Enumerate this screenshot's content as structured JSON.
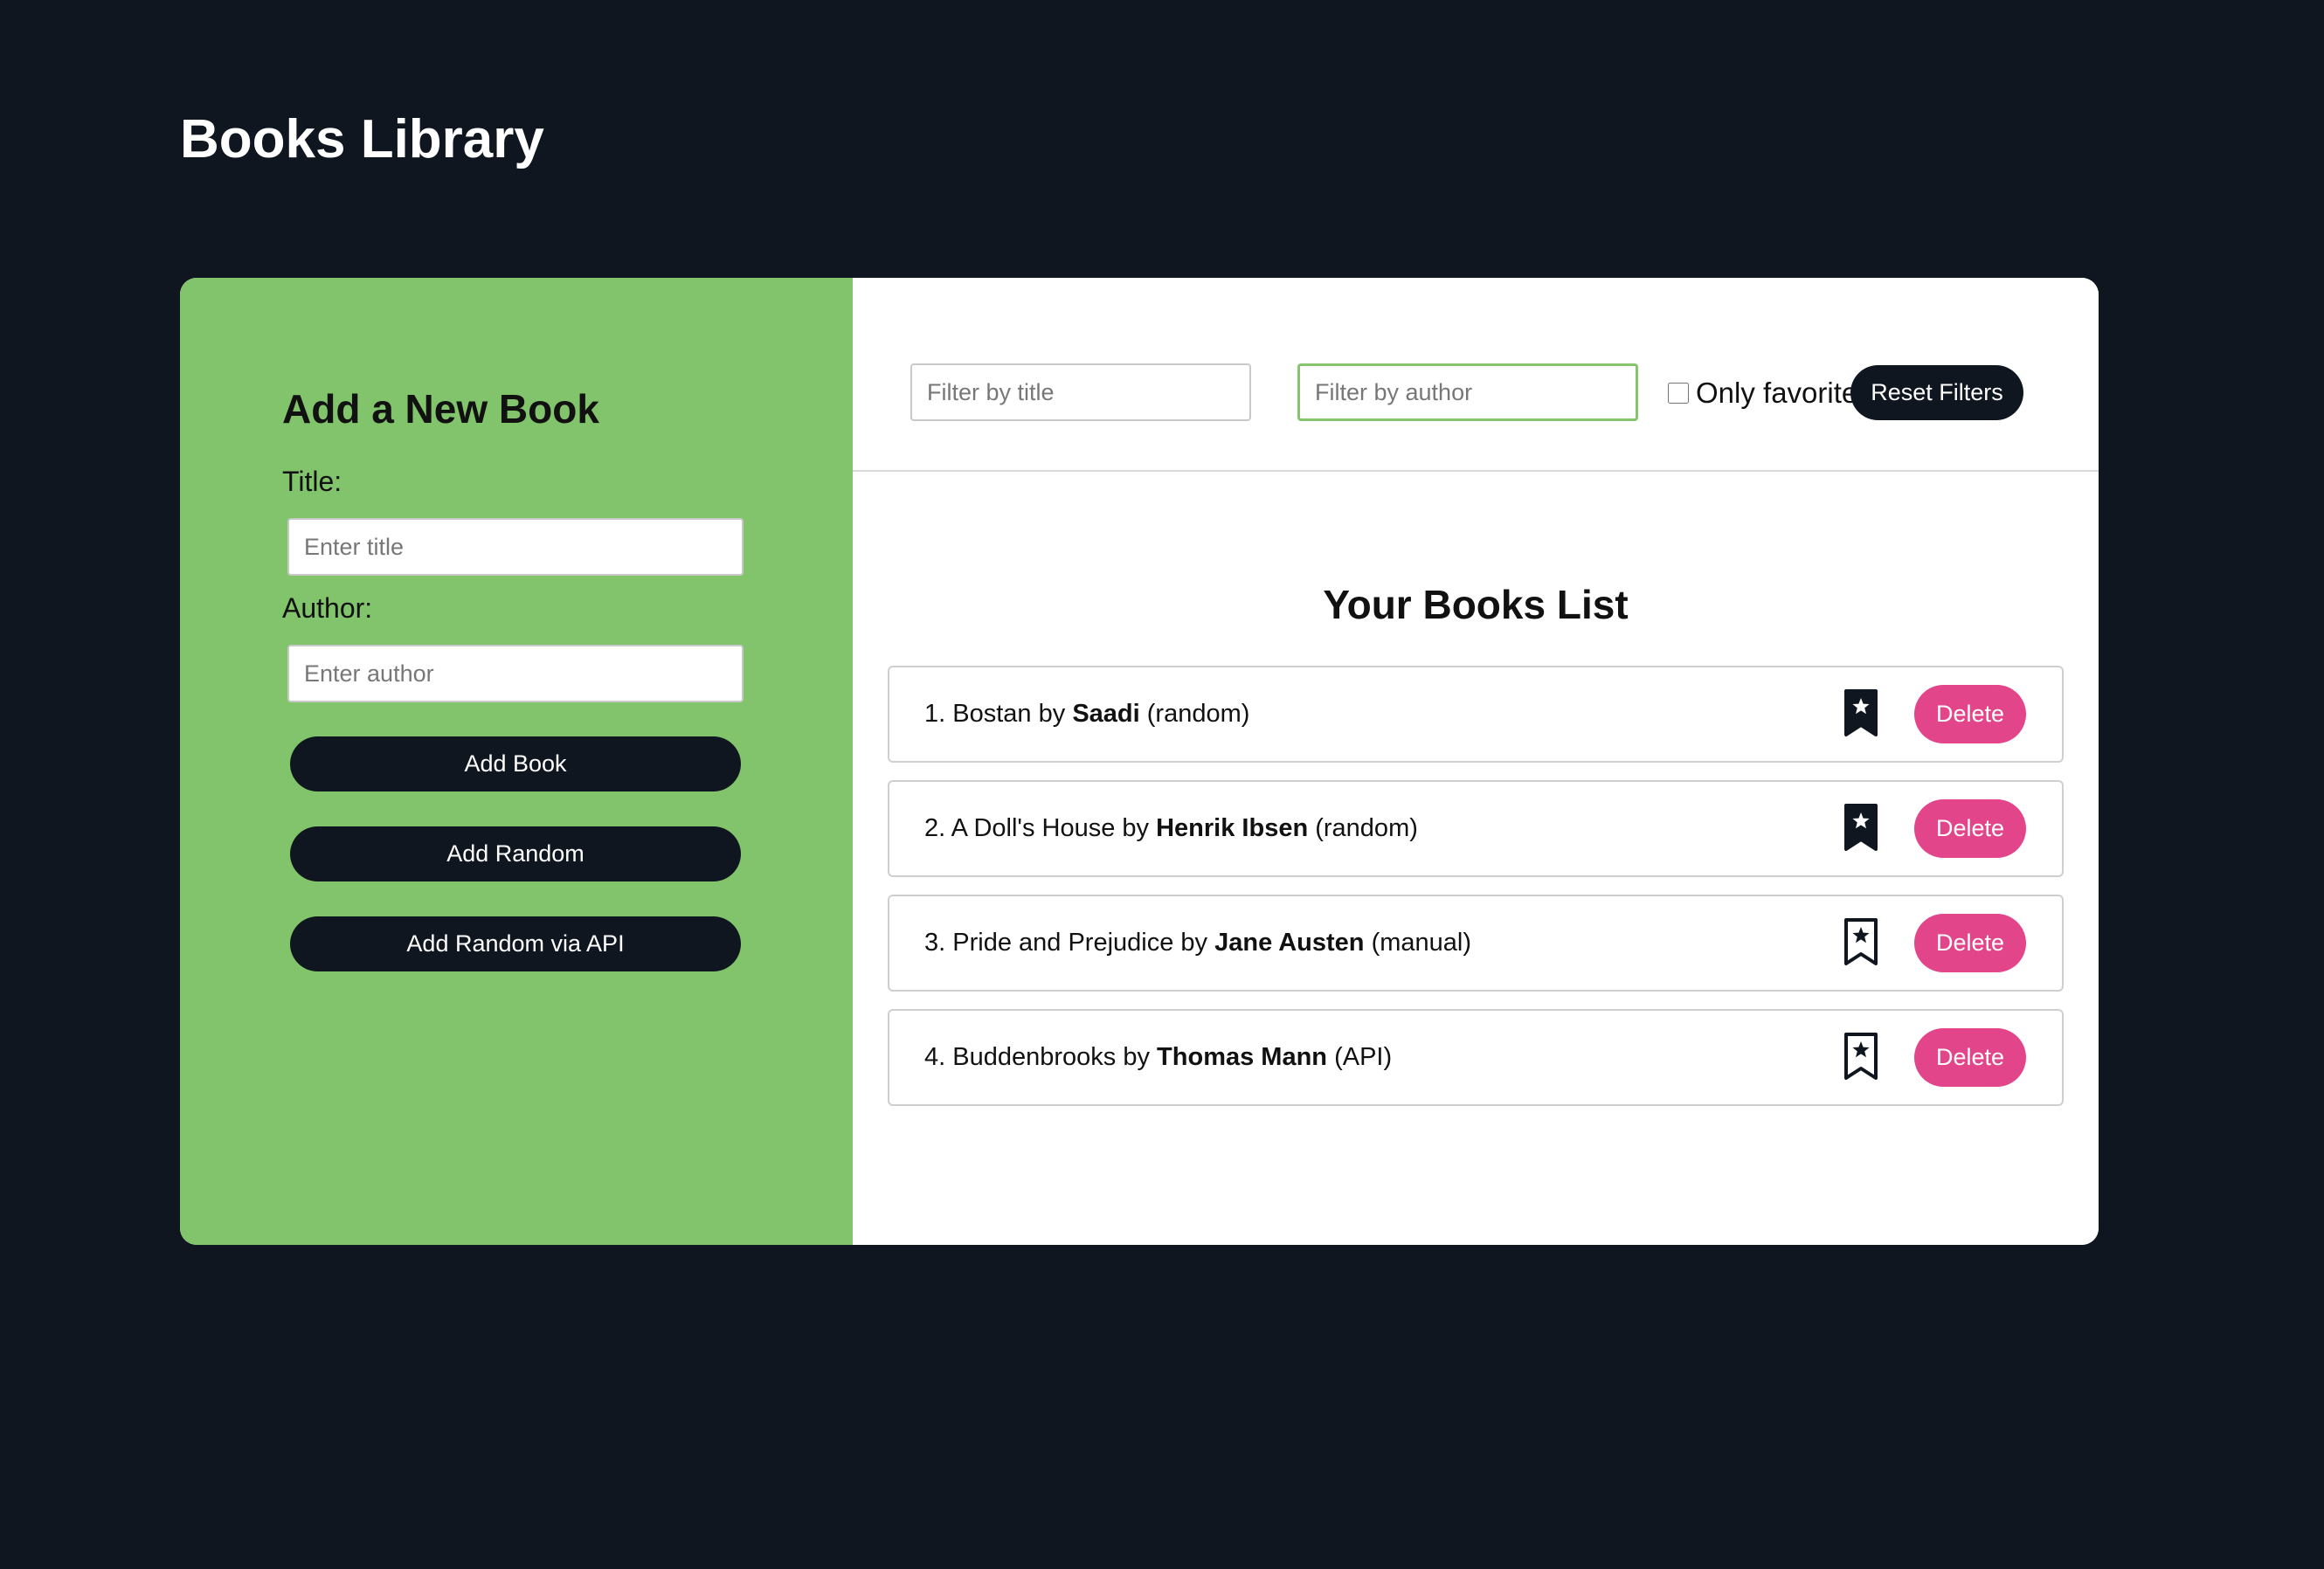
{
  "app": {
    "title": "Books Library"
  },
  "colors": {
    "background": "#10161f",
    "form_panel": "#81c46b",
    "dark_button": "#10161f",
    "delete_button": "#e3458a",
    "active_input_border": "#86c46e"
  },
  "add_form": {
    "heading": "Add a New Book",
    "title_label": "Title:",
    "title_placeholder": "Enter title",
    "title_value": "",
    "author_label": "Author:",
    "author_placeholder": "Enter author",
    "author_value": "",
    "add_book_label": "Add Book",
    "add_random_label": "Add Random",
    "add_random_api_label": "Add Random via API"
  },
  "filters": {
    "title_placeholder": "Filter by title",
    "title_value": "",
    "author_placeholder": "Filter by author",
    "author_value": "",
    "favorite_label": "Only favorite",
    "favorite_checked": false,
    "reset_label": "Reset Filters"
  },
  "list": {
    "heading": "Your Books List",
    "delete_label": "Delete",
    "favorite_icon": "bookmark-star-icon",
    "books": [
      {
        "number": "1.",
        "title": "Bostan",
        "by": "by",
        "author": "Saadi",
        "source": "(random)",
        "favorite": true
      },
      {
        "number": "2.",
        "title": "A Doll's House",
        "by": "by",
        "author": "Henrik Ibsen",
        "source": "(random)",
        "favorite": true
      },
      {
        "number": "3.",
        "title": "Pride and Prejudice",
        "by": "by",
        "author": "Jane Austen",
        "source": "(manual)",
        "favorite": false
      },
      {
        "number": "4.",
        "title": "Buddenbrooks",
        "by": "by",
        "author": "Thomas Mann",
        "source": "(API)",
        "favorite": false
      }
    ]
  }
}
